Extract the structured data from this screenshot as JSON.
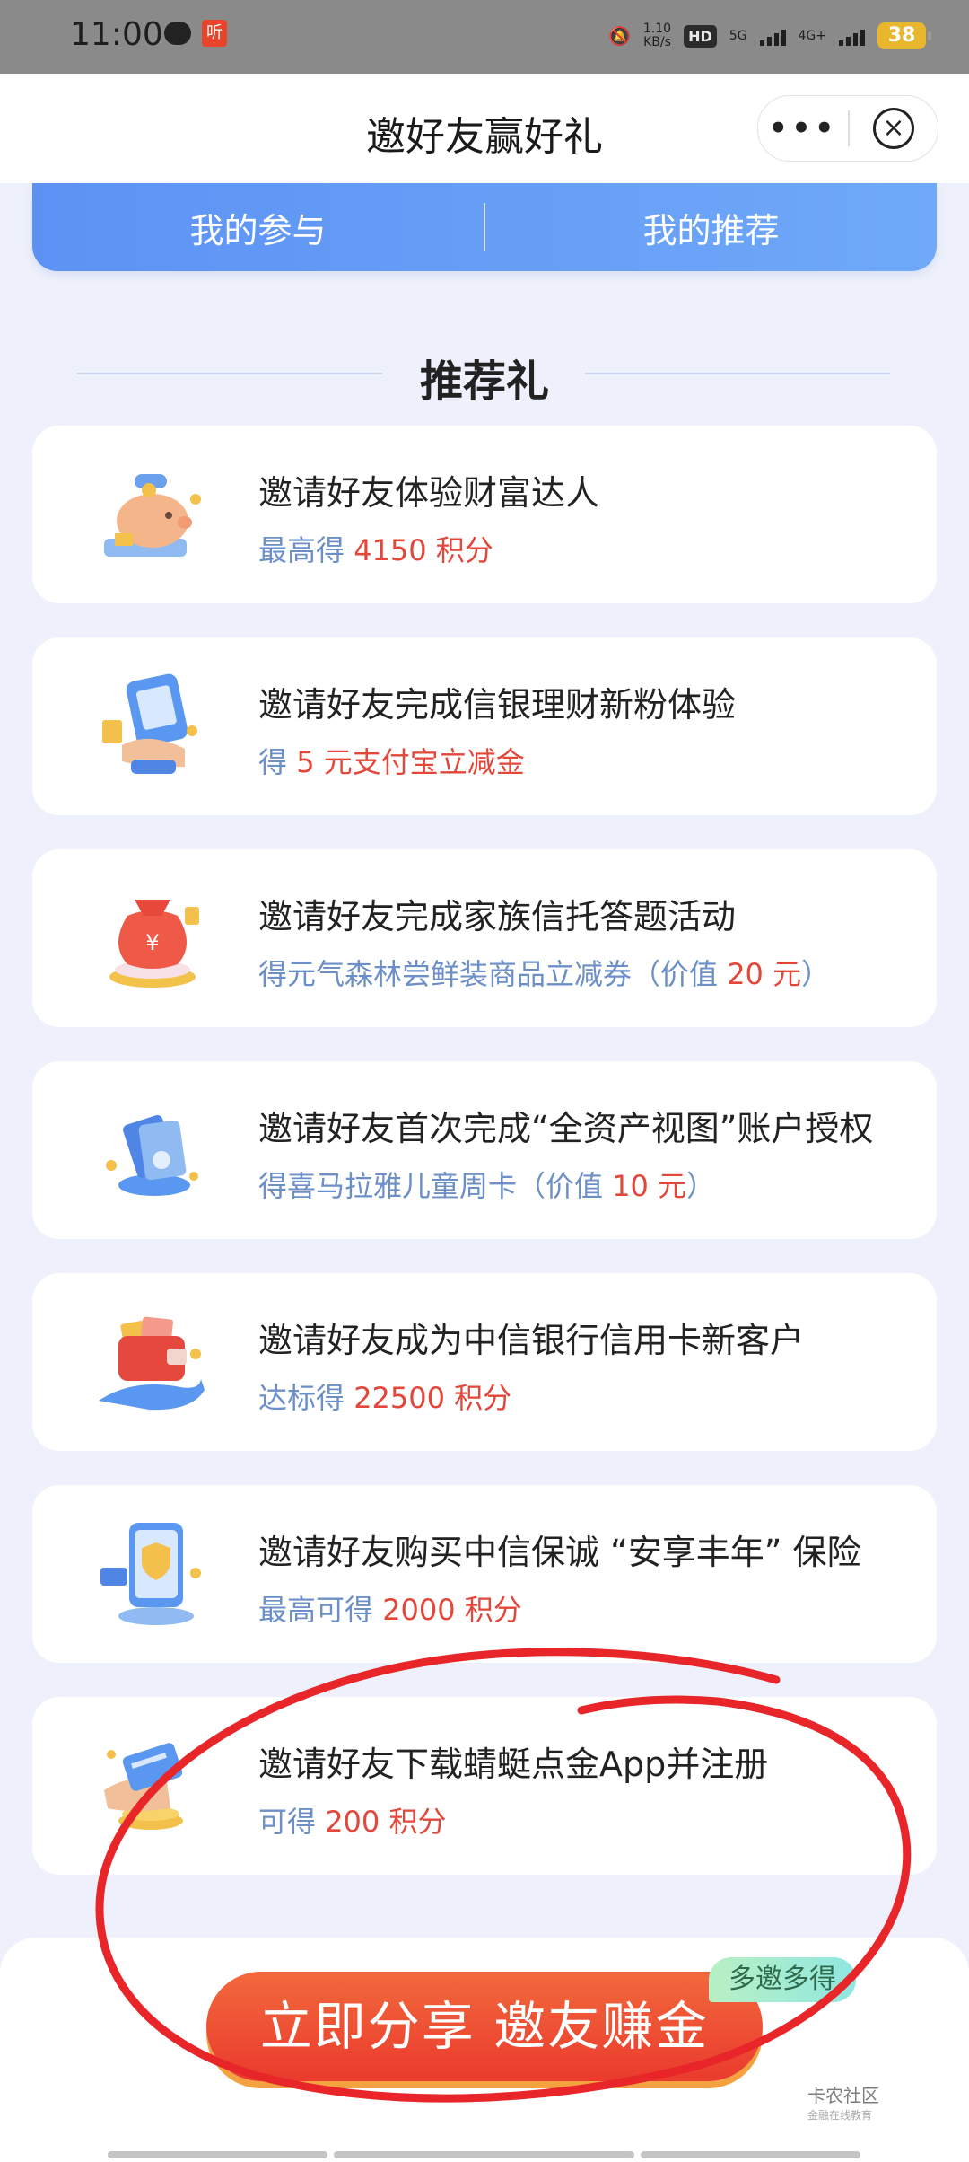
{
  "status_bar": {
    "time": "11:00",
    "app_badge": "听",
    "net_speed_value": "1.10",
    "net_speed_unit": "KB/s",
    "hd_label": "HD",
    "sig1": "5G",
    "sig2": "4G+",
    "battery": "38"
  },
  "header": {
    "title": "邀好友赢好礼",
    "more_label": "•••",
    "close_label": "×"
  },
  "tabs": [
    {
      "label": "我的参与"
    },
    {
      "label": "我的推荐"
    }
  ],
  "section": {
    "title": "推荐礼"
  },
  "cards": [
    {
      "title": "邀请好友体验财富达人",
      "reward_pre": "最高得 ",
      "reward_hl": "4150 积分",
      "reward_post": "",
      "icon": "piggy-bank-icon"
    },
    {
      "title": "邀请好友完成信银理财新粉体验",
      "reward_pre": "得 ",
      "reward_hl": "5 元支付宝立减金",
      "reward_post": "",
      "icon": "calculator-hand-icon"
    },
    {
      "title": "邀请好友完成家族信托答题活动",
      "reward_pre": "得元气森林尝鲜装商品立减券（价值 ",
      "reward_hl": "20 元",
      "reward_post": "）",
      "icon": "money-bag-icon"
    },
    {
      "title": "邀请好友首次完成“全资产视图”账户授权",
      "reward_pre": "得喜马拉雅儿童周卡（价值 ",
      "reward_hl": "10 元",
      "reward_post": "）",
      "icon": "cards-icon"
    },
    {
      "title": "邀请好友成为中信银行信用卡新客户",
      "reward_pre": "达标得 ",
      "reward_hl": "22500 积分",
      "reward_post": "",
      "icon": "wallet-hand-icon"
    },
    {
      "title": "邀请好友购买中信保诚 “安享丰年” 保险",
      "reward_pre": "最高可得 ",
      "reward_hl": "2000 积分",
      "reward_post": "",
      "icon": "phone-shield-icon"
    },
    {
      "title": "邀请好友下载蜻蜓点金App并注册",
      "reward_pre": "可得 ",
      "reward_hl": "200 积分",
      "reward_post": "",
      "icon": "card-coins-icon"
    }
  ],
  "share": {
    "button_label": "立即分享 邀友赚金",
    "badge": "多邀多得"
  },
  "watermark": {
    "name": "卡农社区",
    "sub": "金融在线教育"
  },
  "colors": {
    "accent_blue": "#5d92f4",
    "reward_highlight": "#e2473a",
    "reward_text": "#6b8fc6",
    "share_button": "#ea3a2d",
    "annotation_red": "#e8262a"
  }
}
